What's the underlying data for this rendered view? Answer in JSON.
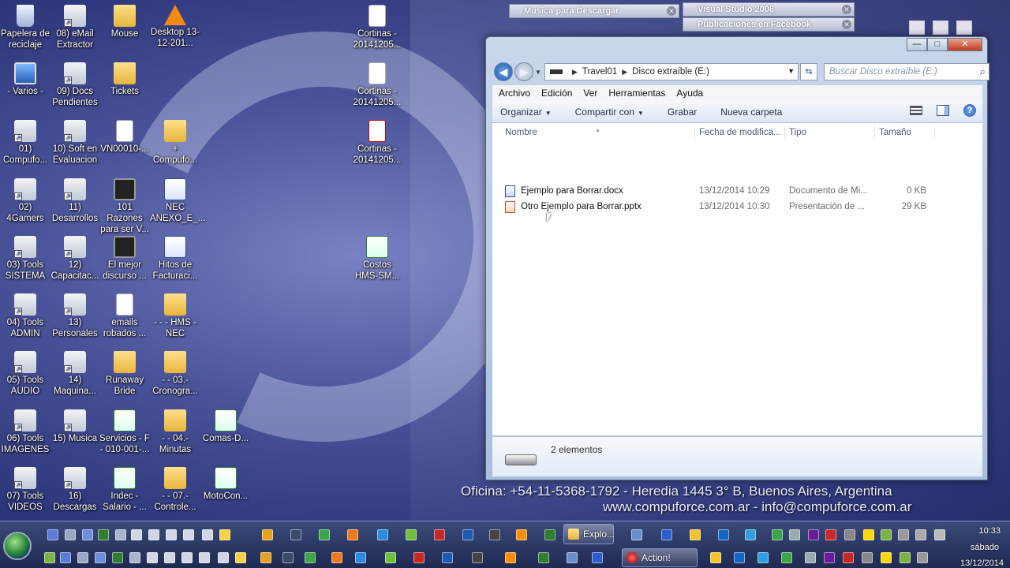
{
  "desktop": {
    "icons": [
      {
        "label": "Papelera de reciclaje",
        "icon": "recycle-bin-icon"
      },
      {
        "label": "08) eMail Extractor",
        "icon": "shortcut-icon"
      },
      {
        "label": "Mouse",
        "icon": "folder-icon"
      },
      {
        "label": "Desktop 13-12-201...",
        "icon": "vlc-icon"
      },
      {
        "label": "Cortinas - 20141205...",
        "icon": "document-icon"
      },
      {
        "label": "- Varios -",
        "icon": "monitor-icon"
      },
      {
        "label": "09) Docs Pendientes",
        "icon": "shortcut-icon"
      },
      {
        "label": "Tickets",
        "icon": "folder-icon"
      },
      {
        "label": "Cortinas - 20141205...",
        "icon": "document-icon"
      },
      {
        "label": "01) Compufo...",
        "icon": "shortcut-icon"
      },
      {
        "label": "10) Soft en Evaluacion",
        "icon": "shortcut-icon"
      },
      {
        "label": "VN00010-...",
        "icon": "music-file-icon"
      },
      {
        "label": "+ Compufo...",
        "icon": "folder-icon"
      },
      {
        "label": "Cortinas - 20141205...",
        "icon": "pdf-icon"
      },
      {
        "label": "02) 4Gamers",
        "icon": "shortcut-icon"
      },
      {
        "label": "11) Desarrollos",
        "icon": "shortcut-icon"
      },
      {
        "label": "101 Razones para ser V...",
        "icon": "video-icon"
      },
      {
        "label": "NEC ANEXO_E_...",
        "icon": "word-icon"
      },
      {
        "label": "03) Tools SISTEMA",
        "icon": "shortcut-icon"
      },
      {
        "label": "12) Capacitac...",
        "icon": "shortcut-icon"
      },
      {
        "label": "El mejor discurso ...",
        "icon": "video-icon"
      },
      {
        "label": "Hitos de Facturaci...",
        "icon": "word-icon"
      },
      {
        "label": "Costos HMS-SM...",
        "icon": "excel-icon"
      },
      {
        "label": "04) Tools ADMIN",
        "icon": "shortcut-icon"
      },
      {
        "label": "13) Personales",
        "icon": "shortcut-icon"
      },
      {
        "label": "emails robados ...",
        "icon": "document-icon"
      },
      {
        "label": "- - - HMS - NEC",
        "icon": "folder-icon"
      },
      {
        "label": "05) Tools AUDIO",
        "icon": "shortcut-icon"
      },
      {
        "label": "14) Maquina...",
        "icon": "shortcut-icon"
      },
      {
        "label": "Runaway Bride",
        "icon": "folder-icon"
      },
      {
        "label": "- - 03.- Cronogra...",
        "icon": "folder-icon"
      },
      {
        "label": "06) Tools IMAGENES",
        "icon": "shortcut-icon"
      },
      {
        "label": "15) Musica",
        "icon": "shortcut-icon"
      },
      {
        "label": "Servicios - F - 010-001-...",
        "icon": "excel-icon"
      },
      {
        "label": "- - 04.- Minutas",
        "icon": "folder-icon"
      },
      {
        "label": "Comas-D...",
        "icon": "excel-icon"
      },
      {
        "label": "07) Tools VIDEOS",
        "icon": "shortcut-icon"
      },
      {
        "label": "16) Descargas",
        "icon": "shortcut-icon"
      },
      {
        "label": "Indec - Salario - ...",
        "icon": "excel-icon"
      },
      {
        "label": "- - 07.- Controle...",
        "icon": "folder-icon"
      },
      {
        "label": "MotoCon...",
        "icon": "excel-icon"
      }
    ],
    "wallpaper_text": {
      "line1": "Oficina: +54-11-5368-1792  -  Heredia 1445 3° B, Buenos Aires, Argentina",
      "line2": "www.compuforce.com.ar  -  info@compuforce.com.ar"
    },
    "browser_tabs": [
      "Musica para Descargar",
      "Visual Studio 2008",
      "Publicaciones en Facebook"
    ]
  },
  "explorer": {
    "window_controls": {
      "minimize": "—",
      "maximize": "□",
      "close": "✕"
    },
    "address": {
      "segments": [
        "Travel01",
        "Disco extraíble (E:)"
      ]
    },
    "search_placeholder": "Buscar Disco extraíble (E:)",
    "menu": [
      "Archivo",
      "Edición",
      "Ver",
      "Herramientas",
      "Ayuda"
    ],
    "toolbar": {
      "organize": "Organizar",
      "share": "Compartir con",
      "burn": "Grabar",
      "new_folder": "Nueva carpeta"
    },
    "columns": {
      "name": "Nombre",
      "date": "Fecha de modifica...",
      "type": "Tipo",
      "size": "Tamaño"
    },
    "files": [
      {
        "name": "Ejemplo para Borrar.docx",
        "date": "13/12/2014 10:29",
        "type": "Documento de Mi...",
        "size": "0 KB",
        "icon": "word-document-icon"
      },
      {
        "name": "Otro Ejemplo para Borrar.pptx",
        "date": "13/12/2014 10:30",
        "type": "Presentación de ...",
        "size": "29 KB",
        "icon": "powerpoint-document-icon"
      }
    ],
    "status": {
      "count": "2 elementos"
    }
  },
  "taskbar": {
    "buttons": {
      "explorer": "Explo...",
      "action": "Action!"
    },
    "clock": {
      "time": "10:33",
      "day": "sábado",
      "date": "13/12/2014"
    }
  },
  "colors": {
    "window_frame": "#b5c8e2",
    "taskbar": "#26325e",
    "accent": "#1d58b0"
  }
}
